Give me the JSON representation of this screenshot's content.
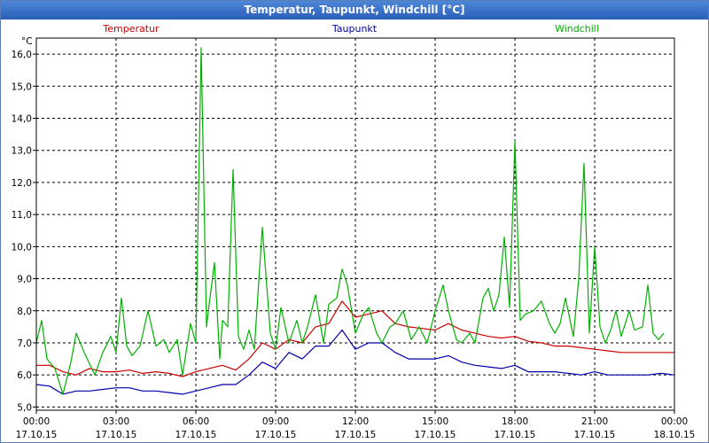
{
  "window": {
    "title": "Temperatur, Taupunkt, Windchill [°C]"
  },
  "chart_data": {
    "type": "line",
    "title": "Temperatur, Taupunkt, Windchill [°C]",
    "ylabel": "°C",
    "xlabel": "",
    "ylim": [
      4.9,
      16.5
    ],
    "xlim_hours": [
      0,
      24
    ],
    "grid": true,
    "yticks": [
      "5,0",
      "6,0",
      "7,0",
      "8,0",
      "9,0",
      "10,0",
      "11,0",
      "12,0",
      "13,0",
      "14,0",
      "15,0",
      "16,0"
    ],
    "ytick_values": [
      5,
      6,
      7,
      8,
      9,
      10,
      11,
      12,
      13,
      14,
      15,
      16
    ],
    "xticks": [
      {
        "time": "00:00",
        "date": "17.10.15",
        "hour": 0
      },
      {
        "time": "03:00",
        "date": "17.10.15",
        "hour": 3
      },
      {
        "time": "06:00",
        "date": "17.10.15",
        "hour": 6
      },
      {
        "time": "09:00",
        "date": "17.10.15",
        "hour": 9
      },
      {
        "time": "12:00",
        "date": "17.10.15",
        "hour": 12
      },
      {
        "time": "15:00",
        "date": "17.10.15",
        "hour": 15
      },
      {
        "time": "18:00",
        "date": "17.10.15",
        "hour": 18
      },
      {
        "time": "21:00",
        "date": "17.10.15",
        "hour": 21
      },
      {
        "time": "00:00",
        "date": "18.10.15",
        "hour": 24
      }
    ],
    "series": [
      {
        "name": "Temperatur",
        "color": "#cc0000",
        "points": [
          [
            0,
            6.3
          ],
          [
            0.5,
            6.3
          ],
          [
            1,
            6.1
          ],
          [
            1.5,
            6.0
          ],
          [
            2,
            6.2
          ],
          [
            2.5,
            6.1
          ],
          [
            3,
            6.1
          ],
          [
            3.5,
            6.15
          ],
          [
            4,
            6.05
          ],
          [
            4.5,
            6.1
          ],
          [
            5,
            6.05
          ],
          [
            5.5,
            5.95
          ],
          [
            6,
            6.1
          ],
          [
            6.5,
            6.2
          ],
          [
            7,
            6.3
          ],
          [
            7.5,
            6.15
          ],
          [
            8,
            6.5
          ],
          [
            8.5,
            7.0
          ],
          [
            9,
            6.8
          ],
          [
            9.5,
            7.1
          ],
          [
            10,
            7.0
          ],
          [
            10.5,
            7.5
          ],
          [
            11,
            7.6
          ],
          [
            11.5,
            8.3
          ],
          [
            12,
            7.8
          ],
          [
            12.5,
            7.9
          ],
          [
            13,
            8.0
          ],
          [
            13.5,
            7.6
          ],
          [
            14,
            7.5
          ],
          [
            14.5,
            7.45
          ],
          [
            15,
            7.4
          ],
          [
            15.5,
            7.6
          ],
          [
            16,
            7.4
          ],
          [
            16.5,
            7.3
          ],
          [
            17,
            7.2
          ],
          [
            17.5,
            7.15
          ],
          [
            18,
            7.2
          ],
          [
            18.5,
            7.05
          ],
          [
            19,
            7.0
          ],
          [
            19.5,
            6.9
          ],
          [
            20,
            6.9
          ],
          [
            20.5,
            6.85
          ],
          [
            21,
            6.8
          ],
          [
            21.5,
            6.75
          ],
          [
            22,
            6.7
          ],
          [
            22.5,
            6.7
          ],
          [
            23,
            6.7
          ],
          [
            23.5,
            6.7
          ],
          [
            24,
            6.7
          ]
        ]
      },
      {
        "name": "Taupunkt",
        "color": "#0000aa",
        "points": [
          [
            0,
            5.7
          ],
          [
            0.5,
            5.65
          ],
          [
            1,
            5.4
          ],
          [
            1.5,
            5.5
          ],
          [
            2,
            5.5
          ],
          [
            2.5,
            5.55
          ],
          [
            3,
            5.6
          ],
          [
            3.5,
            5.6
          ],
          [
            4,
            5.5
          ],
          [
            4.5,
            5.5
          ],
          [
            5,
            5.45
          ],
          [
            5.5,
            5.4
          ],
          [
            6,
            5.5
          ],
          [
            6.5,
            5.6
          ],
          [
            7,
            5.7
          ],
          [
            7.5,
            5.7
          ],
          [
            8,
            6.0
          ],
          [
            8.5,
            6.4
          ],
          [
            9,
            6.2
          ],
          [
            9.5,
            6.7
          ],
          [
            10,
            6.5
          ],
          [
            10.5,
            6.9
          ],
          [
            11,
            6.9
          ],
          [
            11.5,
            7.4
          ],
          [
            12,
            6.8
          ],
          [
            12.5,
            7.0
          ],
          [
            13,
            7.0
          ],
          [
            13.5,
            6.7
          ],
          [
            14,
            6.5
          ],
          [
            14.5,
            6.5
          ],
          [
            15,
            6.5
          ],
          [
            15.5,
            6.6
          ],
          [
            16,
            6.4
          ],
          [
            16.5,
            6.3
          ],
          [
            17,
            6.25
          ],
          [
            17.5,
            6.2
          ],
          [
            18,
            6.3
          ],
          [
            18.5,
            6.1
          ],
          [
            19,
            6.1
          ],
          [
            19.5,
            6.1
          ],
          [
            20,
            6.05
          ],
          [
            20.5,
            6.0
          ],
          [
            21,
            6.1
          ],
          [
            21.5,
            6.0
          ],
          [
            22,
            6.0
          ],
          [
            22.5,
            6.0
          ],
          [
            23,
            6.0
          ],
          [
            23.5,
            6.05
          ],
          [
            24,
            6.0
          ]
        ]
      },
      {
        "name": "Windchill",
        "color": "#00b000",
        "points": [
          [
            0,
            7.0
          ],
          [
            0.2,
            7.7
          ],
          [
            0.4,
            6.5
          ],
          [
            0.7,
            6.2
          ],
          [
            1,
            5.4
          ],
          [
            1.3,
            6.4
          ],
          [
            1.5,
            7.3
          ],
          [
            1.8,
            6.7
          ],
          [
            2.2,
            6.0
          ],
          [
            2.5,
            6.7
          ],
          [
            2.8,
            7.2
          ],
          [
            3,
            6.7
          ],
          [
            3.2,
            8.4
          ],
          [
            3.4,
            6.9
          ],
          [
            3.6,
            6.6
          ],
          [
            3.9,
            6.9
          ],
          [
            4.2,
            8.0
          ],
          [
            4.5,
            6.9
          ],
          [
            4.8,
            7.1
          ],
          [
            5,
            6.7
          ],
          [
            5.3,
            7.1
          ],
          [
            5.5,
            6.0
          ],
          [
            5.8,
            7.6
          ],
          [
            6,
            7.0
          ],
          [
            6.2,
            16.2
          ],
          [
            6.4,
            7.5
          ],
          [
            6.5,
            8.2
          ],
          [
            6.7,
            9.5
          ],
          [
            6.9,
            6.5
          ],
          [
            7.0,
            7.7
          ],
          [
            7.2,
            7.5
          ],
          [
            7.4,
            12.4
          ],
          [
            7.6,
            7.2
          ],
          [
            7.8,
            6.8
          ],
          [
            8.0,
            7.4
          ],
          [
            8.2,
            6.8
          ],
          [
            8.5,
            10.6
          ],
          [
            8.8,
            7.3
          ],
          [
            9.0,
            6.8
          ],
          [
            9.2,
            8.1
          ],
          [
            9.5,
            7.0
          ],
          [
            9.8,
            7.7
          ],
          [
            10.0,
            7.0
          ],
          [
            10.2,
            7.5
          ],
          [
            10.5,
            8.5
          ],
          [
            10.8,
            7.0
          ],
          [
            11.0,
            8.2
          ],
          [
            11.3,
            8.4
          ],
          [
            11.5,
            9.3
          ],
          [
            11.7,
            8.8
          ],
          [
            12.0,
            7.3
          ],
          [
            12.3,
            7.9
          ],
          [
            12.5,
            8.1
          ],
          [
            12.8,
            7.3
          ],
          [
            13.0,
            7.0
          ],
          [
            13.3,
            7.5
          ],
          [
            13.5,
            7.6
          ],
          [
            13.8,
            8.0
          ],
          [
            14.1,
            7.1
          ],
          [
            14.4,
            7.5
          ],
          [
            14.7,
            7.0
          ],
          [
            15.0,
            8.0
          ],
          [
            15.3,
            8.8
          ],
          [
            15.5,
            8.0
          ],
          [
            15.8,
            7.1
          ],
          [
            16.0,
            7.0
          ],
          [
            16.3,
            7.3
          ],
          [
            16.5,
            7.0
          ],
          [
            16.8,
            8.4
          ],
          [
            17.0,
            8.7
          ],
          [
            17.2,
            8.0
          ],
          [
            17.4,
            8.5
          ],
          [
            17.6,
            10.3
          ],
          [
            17.8,
            8.1
          ],
          [
            18.0,
            13.3
          ],
          [
            18.2,
            7.7
          ],
          [
            18.4,
            7.9
          ],
          [
            18.7,
            8.0
          ],
          [
            19.0,
            8.3
          ],
          [
            19.3,
            7.6
          ],
          [
            19.5,
            7.3
          ],
          [
            19.7,
            7.6
          ],
          [
            19.9,
            8.4
          ],
          [
            20.2,
            7.2
          ],
          [
            20.4,
            9.0
          ],
          [
            20.6,
            12.6
          ],
          [
            20.8,
            7.3
          ],
          [
            21.0,
            10.0
          ],
          [
            21.2,
            7.5
          ],
          [
            21.4,
            7.0
          ],
          [
            21.6,
            7.4
          ],
          [
            21.8,
            8.0
          ],
          [
            22.0,
            7.2
          ],
          [
            22.3,
            8.0
          ],
          [
            22.5,
            7.4
          ],
          [
            22.8,
            7.5
          ],
          [
            23.0,
            8.8
          ],
          [
            23.2,
            7.3
          ],
          [
            23.4,
            7.1
          ],
          [
            23.6,
            7.3
          ]
        ]
      }
    ],
    "legend": [
      "Temperatur",
      "Taupunkt",
      "Windchill"
    ],
    "legend_placement": "top"
  }
}
